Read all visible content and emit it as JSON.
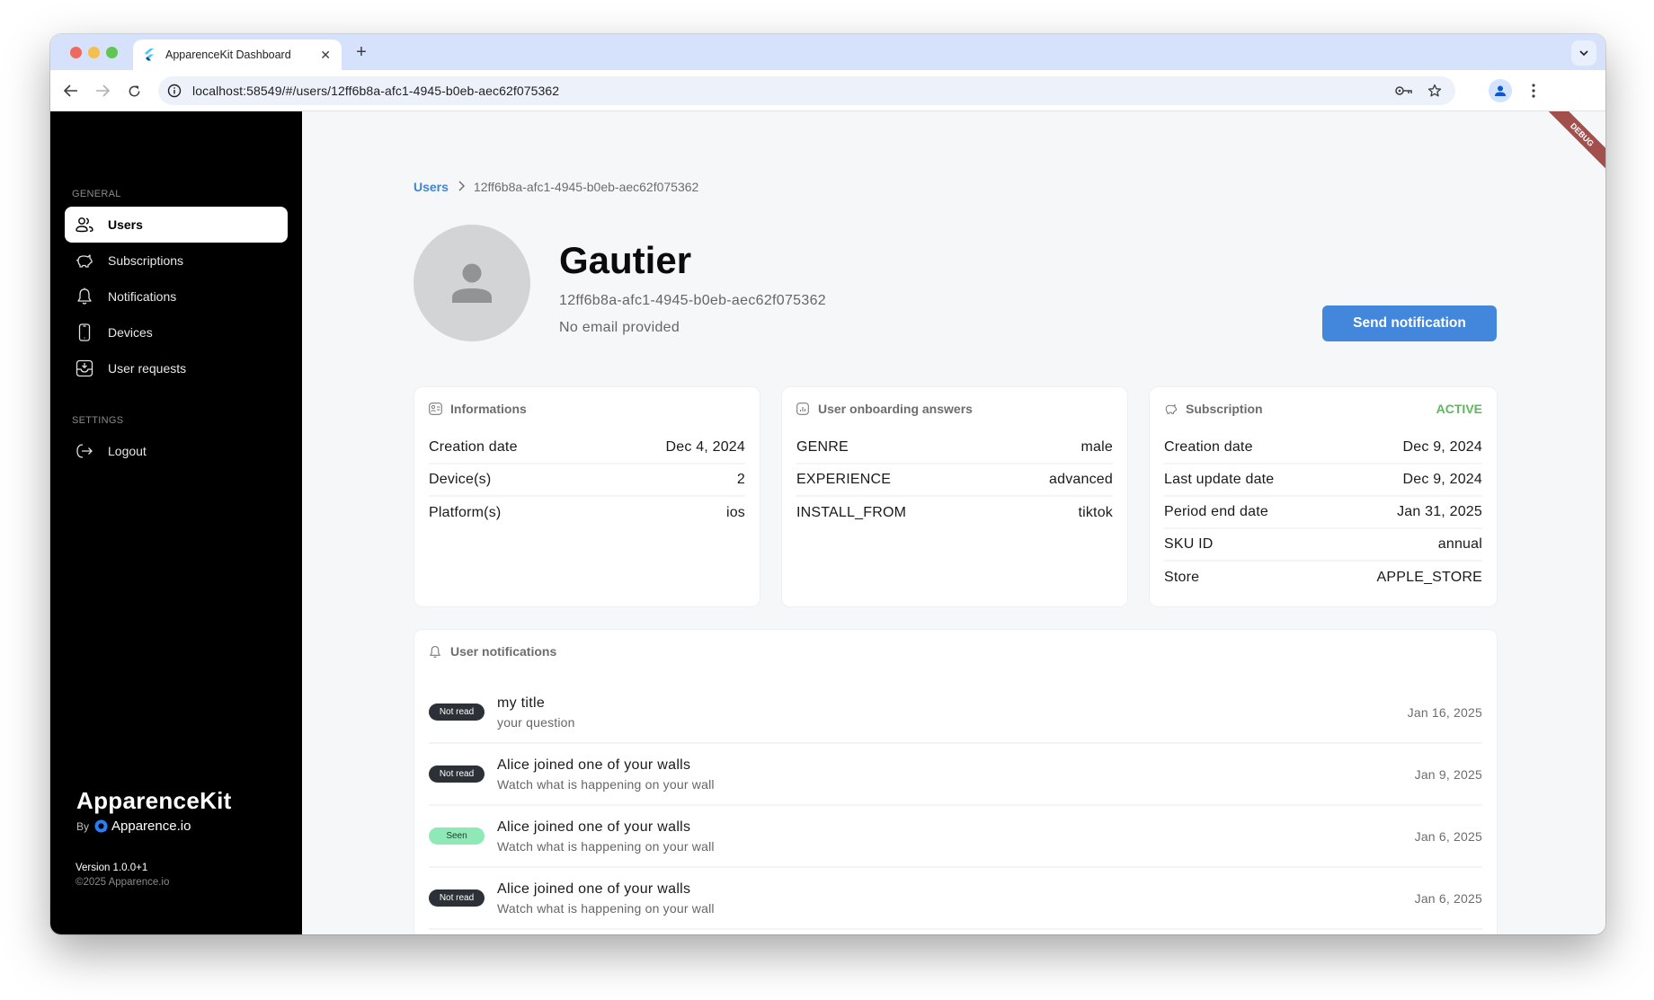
{
  "browser": {
    "tab_title": "ApparenceKit Dashboard",
    "url": "localhost:58549/#/users/12ff6b8a-afc1-4945-b0eb-aec62f075362",
    "new_tab_label": "+",
    "close_tab_label": "✕"
  },
  "sidebar": {
    "general_label": "GENERAL",
    "settings_label": "SETTINGS",
    "items": [
      {
        "label": "Users",
        "icon": "users-icon",
        "active": true
      },
      {
        "label": "Subscriptions",
        "icon": "piggy-bank-icon",
        "active": false
      },
      {
        "label": "Notifications",
        "icon": "bell-icon",
        "active": false
      },
      {
        "label": "Devices",
        "icon": "smartphone-icon",
        "active": false
      },
      {
        "label": "User requests",
        "icon": "inbox-download-icon",
        "active": false
      }
    ],
    "settings_items": [
      {
        "label": "Logout",
        "icon": "logout-icon"
      }
    ],
    "brand": {
      "name": "ApparenceKit",
      "by": "By",
      "company": "Apparence.io"
    },
    "version": "Version 1.0.0+1",
    "copyright": "©2025 Apparence.io"
  },
  "debug_ribbon": "DEBUG",
  "breadcrumb": {
    "root": "Users",
    "separator": "›",
    "current": "12ff6b8a-afc1-4945-b0eb-aec62f075362"
  },
  "user": {
    "name": "Gautier",
    "id": "12ff6b8a-afc1-4945-b0eb-aec62f075362",
    "email": "No email provided"
  },
  "actions": {
    "send_notification": "Send notification"
  },
  "informations": {
    "title": "Informations",
    "rows": [
      {
        "label": "Creation date",
        "value": "Dec 4, 2024"
      },
      {
        "label": "Device(s)",
        "value": "2"
      },
      {
        "label": "Platform(s)",
        "value": "ios"
      }
    ]
  },
  "onboarding": {
    "title": "User onboarding answers",
    "rows": [
      {
        "label": "GENRE",
        "value": "male"
      },
      {
        "label": "EXPERIENCE",
        "value": "advanced"
      },
      {
        "label": "INSTALL_FROM",
        "value": "tiktok"
      }
    ]
  },
  "subscription": {
    "title": "Subscription",
    "status": "ACTIVE",
    "status_color": "#5cb85c",
    "rows": [
      {
        "label": "Creation date",
        "value": "Dec 9, 2024"
      },
      {
        "label": "Last update date",
        "value": "Dec 9, 2024"
      },
      {
        "label": "Period end date",
        "value": "Jan 31, 2025"
      },
      {
        "label": "SKU ID",
        "value": "annual"
      },
      {
        "label": "Store",
        "value": "APPLE_STORE"
      }
    ]
  },
  "notifications": {
    "title": "User notifications",
    "items": [
      {
        "status": "Not read",
        "seen": false,
        "title": "my title",
        "body": "your question",
        "date": "Jan 16, 2025"
      },
      {
        "status": "Not read",
        "seen": false,
        "title": "Alice joined one of your walls",
        "body": "Watch what is happening on your wall",
        "date": "Jan 9, 2025"
      },
      {
        "status": "Seen",
        "seen": true,
        "title": "Alice joined one of your walls",
        "body": "Watch what is happening on your wall",
        "date": "Jan 6, 2025"
      },
      {
        "status": "Not read",
        "seen": false,
        "title": "Alice joined one of your walls",
        "body": "Watch what is happening on your wall",
        "date": "Jan 6, 2025"
      }
    ]
  },
  "colors": {
    "accent": "#4287dc",
    "sidebar_bg": "#000000",
    "badge_unread": "#2b3137",
    "badge_seen": "#8fe9b6"
  }
}
